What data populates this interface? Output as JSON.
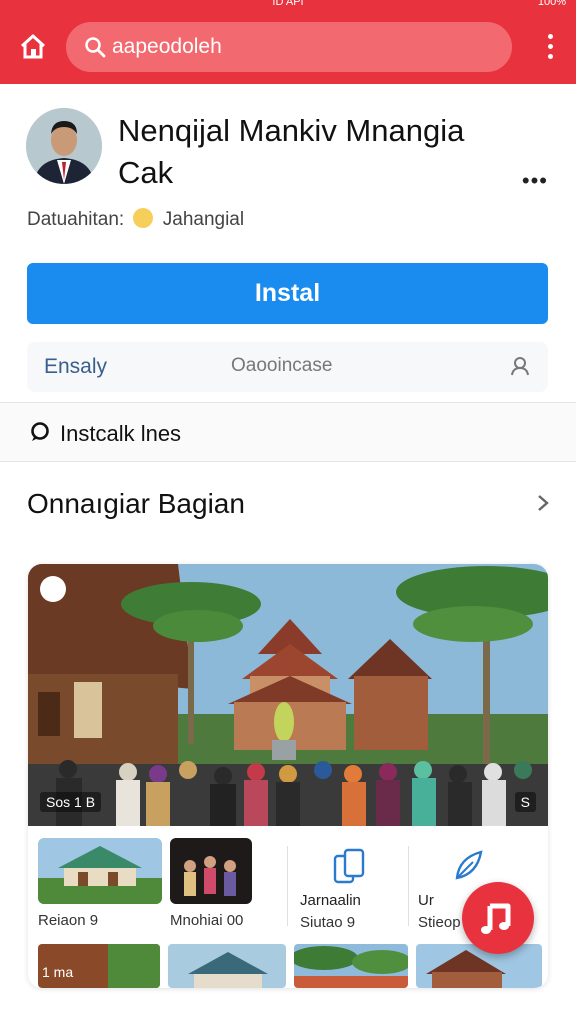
{
  "status_bar": {
    "center_text": "ID API",
    "right_text": "100%"
  },
  "app_bar": {
    "search_text": "aapeodoleh",
    "brand_color": "#e8323e"
  },
  "profile": {
    "title": "Nenqijal Mankiv Mnangia Cak",
    "meta_label": "Datuahitan:",
    "meta_value": "Jahangial",
    "install_label": "Instal",
    "tabs": [
      "Ensaly",
      "Oaooincase"
    ]
  },
  "install_row": {
    "label": "Instcalk lnes"
  },
  "section": {
    "title": "Onnaıgiar Bagian",
    "hero_badge_left": "Sos 1 B",
    "hero_badge_right": "S",
    "thumbs": [
      {
        "caption": "Reiaon 9"
      },
      {
        "caption": "Mnohiai 00"
      },
      {
        "title": "Jarnaalin",
        "caption": "Siutao 9"
      },
      {
        "title": "Ur",
        "caption": "Stieop"
      }
    ],
    "bottom_tiles": [
      {
        "label": "1 ma"
      },
      {
        "label": ""
      },
      {
        "label": ""
      },
      {
        "label": ""
      }
    ]
  },
  "icons": [
    "home-icon",
    "search-icon",
    "more-vertical-icon",
    "more-horizontal-icon",
    "user-icon",
    "chat-bubble-icon",
    "chevron-right-icon",
    "tablet-icon",
    "leaf-icon",
    "music-note-icon"
  ],
  "colors": {
    "accent": "#e8323e",
    "primary_button": "#1a8cf0",
    "tab_text": "#3a5f8c"
  }
}
